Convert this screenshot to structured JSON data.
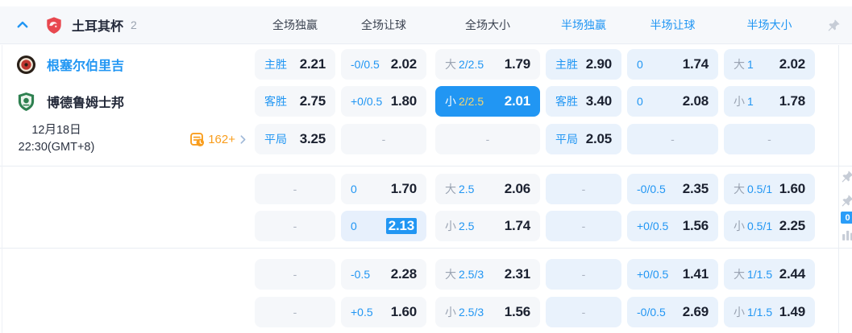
{
  "header": {
    "league_name": "土耳其杯",
    "match_count": "2",
    "columns": [
      "全场独赢",
      "全场让球",
      "全场大小",
      "半场独赢",
      "半场让球",
      "半场大小"
    ]
  },
  "match": {
    "home_team": "根塞尔伯里吉",
    "away_team": "博德鲁姆士邦",
    "date": "12月18日",
    "time": "22:30(GMT+8)",
    "more_markets": "162+"
  },
  "side_badge": "0",
  "colors": {
    "accent_blue": "#2196f3",
    "selected_cell_bg": "#2196f3",
    "selected_line_gold": "#f7d76e",
    "orange": "#f99d1c",
    "ft_cell_bg": "#f5f7fa",
    "ht_cell_bg": "#e9f2fc"
  },
  "sections": [
    {
      "rows": [
        [
          {
            "t": "odds",
            "label": "主胜",
            "value": "2.21"
          },
          {
            "t": "odds",
            "label": "-0/0.5",
            "value": "2.02"
          },
          {
            "t": "ou",
            "prefix": "大",
            "line": "2/2.5",
            "value": "1.79"
          },
          {
            "t": "odds",
            "label": "主胜",
            "value": "2.90"
          },
          {
            "t": "odds",
            "label": "0",
            "value": "1.74"
          },
          {
            "t": "ou",
            "prefix": "大",
            "line": "1",
            "value": "2.02"
          }
        ],
        [
          {
            "t": "odds",
            "label": "客胜",
            "value": "2.75"
          },
          {
            "t": "odds",
            "label": "+0/0.5",
            "value": "1.80"
          },
          {
            "t": "ou",
            "prefix": "小",
            "line": "2/2.5",
            "value": "2.01",
            "selected": true
          },
          {
            "t": "odds",
            "label": "客胜",
            "value": "3.40"
          },
          {
            "t": "odds",
            "label": "0",
            "value": "2.08"
          },
          {
            "t": "ou",
            "prefix": "小",
            "line": "1",
            "value": "1.78"
          }
        ],
        [
          {
            "t": "odds",
            "label": "平局",
            "value": "3.25"
          },
          {
            "t": "dash"
          },
          {
            "t": "dash"
          },
          {
            "t": "odds",
            "label": "平局",
            "value": "2.05"
          },
          {
            "t": "dash"
          },
          {
            "t": "dash"
          }
        ]
      ]
    },
    {
      "rows": [
        [
          {
            "t": "dash"
          },
          {
            "t": "odds",
            "label": "0",
            "value": "1.70"
          },
          {
            "t": "ou",
            "prefix": "大",
            "line": "2.5",
            "value": "2.06"
          },
          {
            "t": "dash"
          },
          {
            "t": "odds",
            "label": "-0/0.5",
            "value": "2.35"
          },
          {
            "t": "ou",
            "prefix": "大",
            "line": "0.5/1",
            "value": "1.60"
          }
        ],
        [
          {
            "t": "dash"
          },
          {
            "t": "odds",
            "label": "0",
            "value": "2.13",
            "value_selected": true
          },
          {
            "t": "ou",
            "prefix": "小",
            "line": "2.5",
            "value": "1.74"
          },
          {
            "t": "dash"
          },
          {
            "t": "odds",
            "label": "+0/0.5",
            "value": "1.56"
          },
          {
            "t": "ou",
            "prefix": "小",
            "line": "0.5/1",
            "value": "2.25"
          }
        ]
      ]
    },
    {
      "rows": [
        [
          {
            "t": "dash"
          },
          {
            "t": "odds",
            "label": "-0.5",
            "value": "2.28"
          },
          {
            "t": "ou",
            "prefix": "大",
            "line": "2.5/3",
            "value": "2.31"
          },
          {
            "t": "dash"
          },
          {
            "t": "odds",
            "label": "+0/0.5",
            "value": "1.41"
          },
          {
            "t": "ou",
            "prefix": "大",
            "line": "1/1.5",
            "value": "2.44"
          }
        ],
        [
          {
            "t": "dash"
          },
          {
            "t": "odds",
            "label": "+0.5",
            "value": "1.60"
          },
          {
            "t": "ou",
            "prefix": "小",
            "line": "2.5/3",
            "value": "1.56"
          },
          {
            "t": "dash"
          },
          {
            "t": "odds",
            "label": "-0/0.5",
            "value": "2.69"
          },
          {
            "t": "ou",
            "prefix": "小",
            "line": "1/1.5",
            "value": "1.49"
          }
        ]
      ]
    }
  ]
}
